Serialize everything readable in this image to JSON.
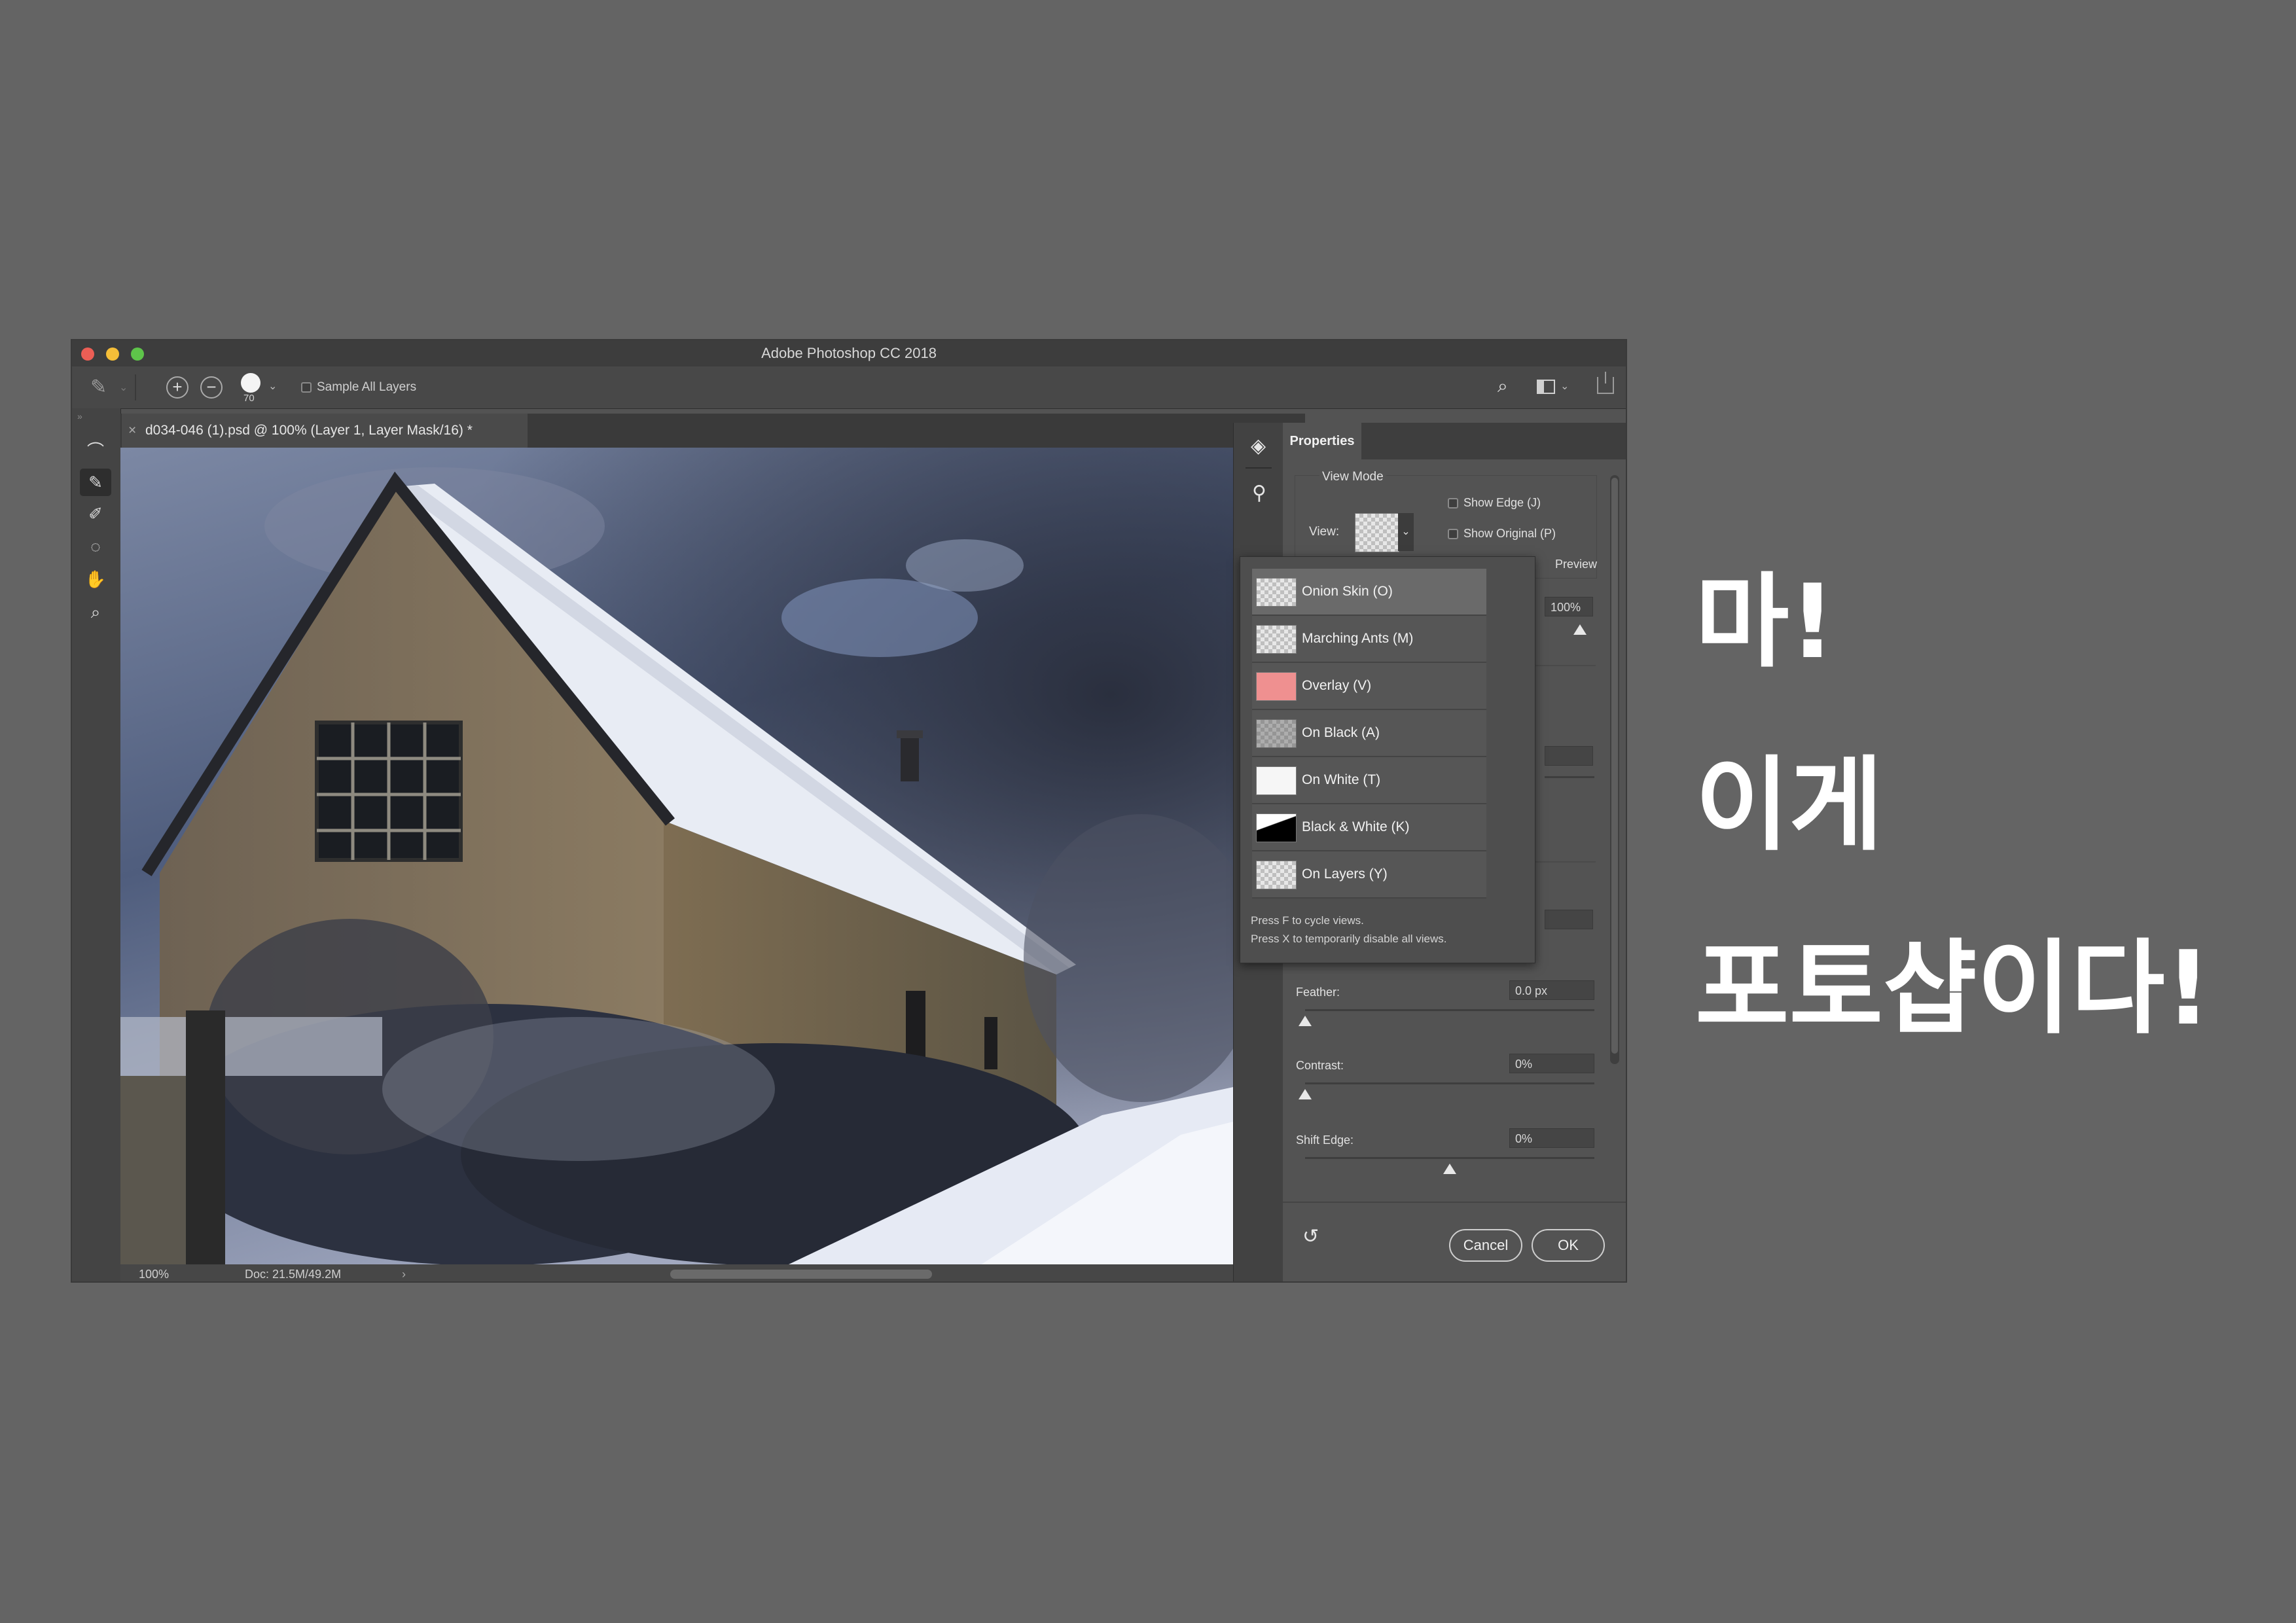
{
  "window": {
    "title": "Adobe Photoshop CC 2018",
    "traffic_lights": {
      "close": "#ec5e55",
      "minimize": "#f5be38",
      "zoom": "#5ec44a"
    }
  },
  "options_bar": {
    "brush_size": "70",
    "sample_all_layers": "Sample All Layers",
    "icons": [
      "refine-brush-icon",
      "add-icon",
      "subtract-icon",
      "search-icon",
      "workspace-icon",
      "share-icon"
    ]
  },
  "document": {
    "tab_label": "d034-046 (1).psd @ 100% (Layer 1, Layer Mask/16) *",
    "close_glyph": "×",
    "zoom": "100%",
    "doc_info": "Doc: 21.5M/49.2M"
  },
  "tools": [
    "quick-selection-icon",
    "refine-edge-brush-icon",
    "brush-icon",
    "lasso-icon",
    "hand-icon",
    "zoom-icon"
  ],
  "properties": {
    "tab": "Properties",
    "view_mode_title": "View Mode",
    "view_label": "View:",
    "show_edge": "Show Edge (J)",
    "show_original": "Show Original (P)",
    "preview": "Preview",
    "opacity_value": "100%",
    "feather_label": "Feather:",
    "feather_value": "0.0 px",
    "feather_level": 0,
    "contrast_label": "Contrast:",
    "contrast_value": "0%",
    "contrast_level": 0,
    "shift_edge_label": "Shift Edge:",
    "shift_edge_value": "0%",
    "shift_edge_level": 0.5,
    "cancel": "Cancel",
    "ok": "OK"
  },
  "view_dropdown": {
    "options": [
      {
        "label": "Onion Skin (O)",
        "selected": true
      },
      {
        "label": "Marching Ants (M)"
      },
      {
        "label": "Overlay (V)"
      },
      {
        "label": "On Black (A)"
      },
      {
        "label": "On White (T)"
      },
      {
        "label": "Black & White (K)"
      },
      {
        "label": "On Layers (Y)"
      }
    ],
    "hint1": "Press F to cycle views.",
    "hint2": "Press X to temporarily disable all views."
  },
  "caption": {
    "line1": "마!",
    "line2": "이게",
    "line3": "포토샵이다!"
  }
}
